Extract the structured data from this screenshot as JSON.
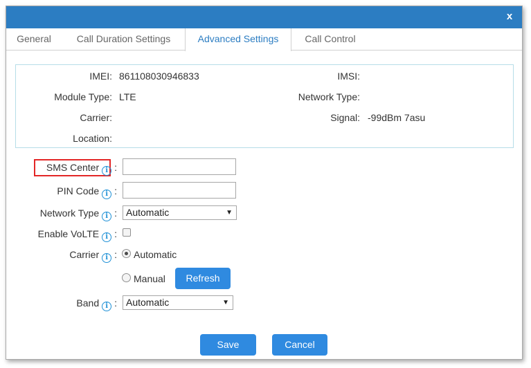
{
  "dialog": {
    "close_label": "x"
  },
  "tabs": [
    {
      "label": "General"
    },
    {
      "label": "Call Duration Settings"
    },
    {
      "label": "Advanced Settings"
    },
    {
      "label": "Call Control"
    }
  ],
  "active_tab": "Advanced Settings",
  "info": {
    "imei_label": "IMEI:",
    "imei_value": "861108030946833",
    "imsi_label": "IMSI:",
    "imsi_value": "",
    "module_type_label": "Module Type:",
    "module_type_value": "LTE",
    "network_type_label": "Network Type:",
    "network_type_value": "",
    "carrier_label": "Carrier:",
    "carrier_value": "",
    "signal_label": "Signal:",
    "signal_value": "-99dBm 7asu",
    "location_label": "Location:",
    "location_value": ""
  },
  "form": {
    "sms_center_label": "SMS Center",
    "sms_center_value": "",
    "pin_code_label": "PIN Code",
    "pin_code_value": "",
    "network_type_label": "Network Type",
    "network_type_selected": "Automatic",
    "enable_volte_label": "Enable VoLTE",
    "enable_volte_checked": false,
    "carrier_label": "Carrier",
    "carrier_option_automatic": "Automatic",
    "carrier_option_manual": "Manual",
    "carrier_selected": "Automatic",
    "refresh_label": "Refresh",
    "band_label": "Band",
    "band_selected": "Automatic",
    "colon": ":",
    "info_glyph": "i"
  },
  "footer": {
    "save_label": "Save",
    "cancel_label": "Cancel"
  },
  "colors": {
    "titlebar": "#2c7dc2",
    "active_tab_text": "#2c7dc2",
    "button": "#2f8ae0",
    "info_icon": "#1e90d6",
    "highlight_box": "#e32626",
    "info_box_border": "#b6dde8"
  },
  "icons": {
    "close": "close-icon",
    "info": "info-icon",
    "select_arrow": "chevron-down-icon"
  }
}
